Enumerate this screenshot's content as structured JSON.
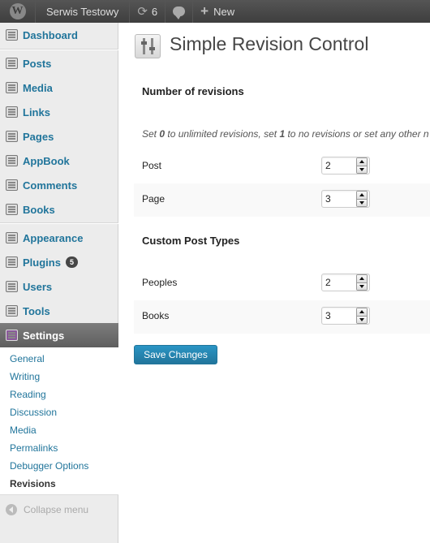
{
  "adminbar": {
    "site_name": "Serwis Testowy",
    "updates_count": "6",
    "new_label": "New"
  },
  "sidebar": {
    "items": [
      {
        "label": "Dashboard",
        "icon": "dashboard-icon"
      },
      {
        "label": "Posts",
        "icon": "pin-icon"
      },
      {
        "label": "Media",
        "icon": "media-icon"
      },
      {
        "label": "Links",
        "icon": "link-icon"
      },
      {
        "label": "Pages",
        "icon": "pages-icon"
      },
      {
        "label": "AppBook",
        "icon": "appbook-icon"
      },
      {
        "label": "Comments",
        "icon": "comment-icon"
      },
      {
        "label": "Books",
        "icon": "pin-icon"
      },
      {
        "label": "Appearance",
        "icon": "appearance-icon"
      },
      {
        "label": "Plugins",
        "icon": "plugin-icon",
        "badge": "5"
      },
      {
        "label": "Users",
        "icon": "users-icon"
      },
      {
        "label": "Tools",
        "icon": "tools-icon"
      },
      {
        "label": "Settings",
        "icon": "settings-icon",
        "current": true
      }
    ],
    "submenu": [
      "General",
      "Writing",
      "Reading",
      "Discussion",
      "Media",
      "Permalinks",
      "Debugger Options",
      "Revisions"
    ],
    "submenu_current": "Revisions",
    "collapse_label": "Collapse menu"
  },
  "main": {
    "title": "Simple Revision Control",
    "section1_title": "Number of revisions",
    "description": {
      "part1": "Set ",
      "bold1": "0",
      "part2": " to unlimited revisions, set ",
      "bold2": "1",
      "part3": " to no revisions or set any other n"
    },
    "rows1": [
      {
        "label": "Post",
        "value": "2"
      },
      {
        "label": "Page",
        "value": "3"
      }
    ],
    "section2_title": "Custom Post Types",
    "rows2": [
      {
        "label": "Peoples",
        "value": "2"
      },
      {
        "label": "Books",
        "value": "3"
      }
    ],
    "save_label": "Save Changes"
  },
  "colors": {
    "link": "#21759b",
    "adminbar": "#464646",
    "sidebar_bg": "#ececec",
    "current_bg": "#6d6d6d",
    "button": "#21759b"
  }
}
